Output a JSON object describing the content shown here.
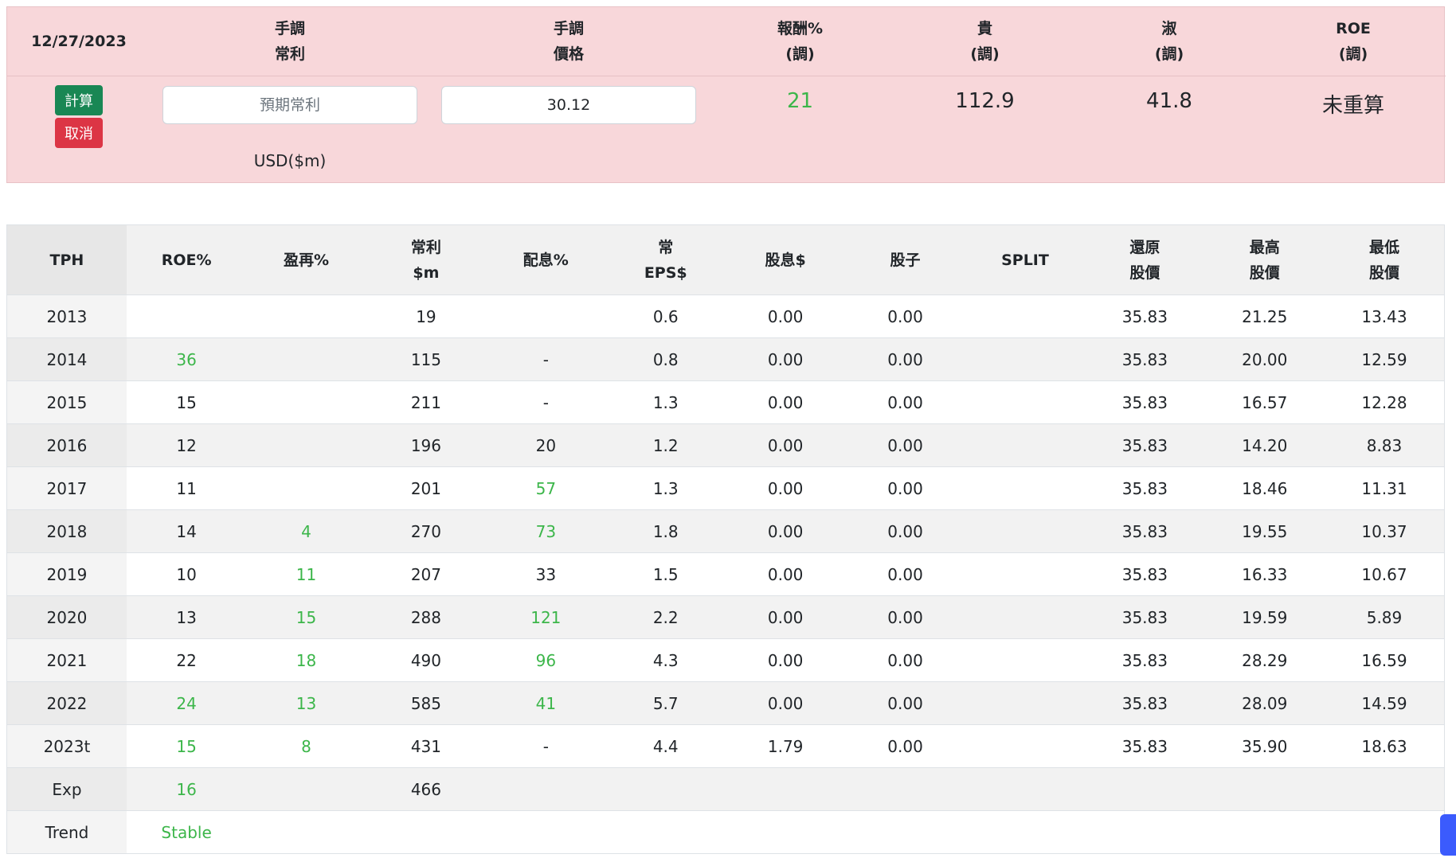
{
  "calc": {
    "date": "12/27/2023",
    "headers": [
      [
        "手調",
        "常利"
      ],
      [
        "手調",
        "價格"
      ],
      [
        "報酬%",
        "(調)"
      ],
      [
        "貴",
        "(調)"
      ],
      [
        "淑",
        "(調)"
      ],
      [
        "ROE",
        "(調)"
      ]
    ],
    "calc_button": "計算",
    "cancel_button": "取消",
    "profit_placeholder": "預期常利",
    "profit_value": "",
    "price_value": "30.12",
    "unit": "USD($m)",
    "return_pct": "21",
    "expensive": "112.9",
    "fair": "41.8",
    "roe": "未重算"
  },
  "table": {
    "headers": [
      [
        "TPH"
      ],
      [
        "ROE%"
      ],
      [
        "盈再%"
      ],
      [
        "常利",
        "$m"
      ],
      [
        "配息%"
      ],
      [
        "常",
        "EPS$"
      ],
      [
        "股息$"
      ],
      [
        "股子"
      ],
      [
        "SPLIT"
      ],
      [
        "還原",
        "股價"
      ],
      [
        "最高",
        "股價"
      ],
      [
        "最低",
        "股價"
      ]
    ],
    "rows": [
      [
        "2013",
        "",
        "",
        "19",
        "",
        "0.6",
        "0.00",
        "0.00",
        "",
        "35.83",
        "21.25",
        "13.43"
      ],
      [
        "2014",
        "36",
        "",
        "115",
        "-",
        "0.8",
        "0.00",
        "0.00",
        "",
        "35.83",
        "20.00",
        "12.59"
      ],
      [
        "2015",
        "15",
        "",
        "211",
        "-",
        "1.3",
        "0.00",
        "0.00",
        "",
        "35.83",
        "16.57",
        "12.28"
      ],
      [
        "2016",
        "12",
        "",
        "196",
        "20",
        "1.2",
        "0.00",
        "0.00",
        "",
        "35.83",
        "14.20",
        "8.83"
      ],
      [
        "2017",
        "11",
        "",
        "201",
        "57",
        "1.3",
        "0.00",
        "0.00",
        "",
        "35.83",
        "18.46",
        "11.31"
      ],
      [
        "2018",
        "14",
        "4",
        "270",
        "73",
        "1.8",
        "0.00",
        "0.00",
        "",
        "35.83",
        "19.55",
        "10.37"
      ],
      [
        "2019",
        "10",
        "11",
        "207",
        "33",
        "1.5",
        "0.00",
        "0.00",
        "",
        "35.83",
        "16.33",
        "10.67"
      ],
      [
        "2020",
        "13",
        "15",
        "288",
        "121",
        "2.2",
        "0.00",
        "0.00",
        "",
        "35.83",
        "19.59",
        "5.89"
      ],
      [
        "2021",
        "22",
        "18",
        "490",
        "96",
        "4.3",
        "0.00",
        "0.00",
        "",
        "35.83",
        "28.29",
        "16.59"
      ],
      [
        "2022",
        "24",
        "13",
        "585",
        "41",
        "5.7",
        "0.00",
        "0.00",
        "",
        "35.83",
        "28.09",
        "14.59"
      ],
      [
        "2023t",
        "15",
        "8",
        "431",
        "-",
        "4.4",
        "1.79",
        "0.00",
        "",
        "35.83",
        "35.90",
        "18.63"
      ],
      [
        "Exp",
        "16",
        "",
        "466",
        "",
        "",
        "",
        "",
        "",
        "",
        "",
        ""
      ],
      [
        "Trend",
        "Stable",
        "",
        "",
        "",
        "",
        "",
        "",
        "",
        "",
        "",
        ""
      ]
    ],
    "green_cells": [
      [
        1,
        1
      ],
      [
        9,
        1
      ],
      [
        10,
        1
      ],
      [
        11,
        1
      ],
      [
        12,
        1
      ],
      [
        5,
        2
      ],
      [
        6,
        2
      ],
      [
        7,
        2
      ],
      [
        8,
        2
      ],
      [
        9,
        2
      ],
      [
        10,
        2
      ],
      [
        4,
        4
      ],
      [
        5,
        4
      ],
      [
        7,
        4
      ],
      [
        8,
        4
      ],
      [
        9,
        4
      ]
    ]
  },
  "colors": {
    "positive": "#3cb64a",
    "panel_bg": "#f8d7da",
    "calc_button": "#198754",
    "cancel_button": "#dc3545"
  }
}
